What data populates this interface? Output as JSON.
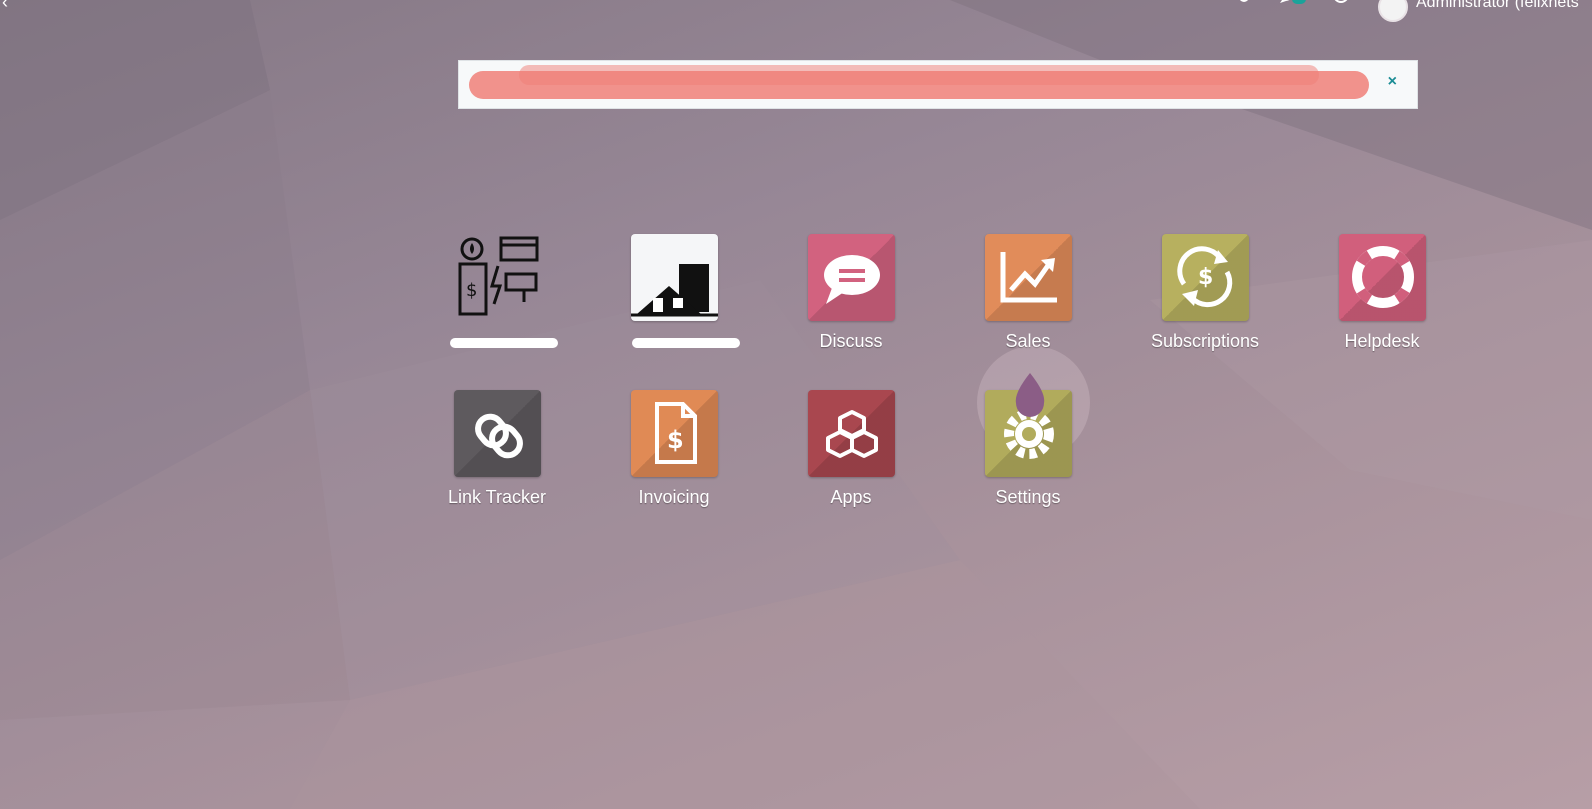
{
  "topbar": {
    "back_icon": "chevron-left-icon",
    "icons": [
      "bug-icon",
      "chat-icon",
      "clock-icon"
    ],
    "user_name": "Administrator (felixnets"
  },
  "notice": {
    "text": "",
    "close_label": "×"
  },
  "apps": [
    {
      "label": "",
      "icon": "utility-bills-icon",
      "color": "#ffffff"
    },
    {
      "label": "",
      "icon": "real-estate-icon",
      "color": "#ffffff"
    },
    {
      "label": "Discuss",
      "icon": "chat-bubble-icon",
      "color": "#d2627f"
    },
    {
      "label": "Sales",
      "icon": "trend-chart-icon",
      "color": "#e18c5a"
    },
    {
      "label": "Subscriptions",
      "icon": "recurring-dollar-icon",
      "color": "#b7b05f"
    },
    {
      "label": "Helpdesk",
      "icon": "lifebuoy-icon",
      "color": "#d15f7c"
    },
    {
      "label": "Link Tracker",
      "icon": "chain-link-icon",
      "color": "#5e5a5e"
    },
    {
      "label": "Invoicing",
      "icon": "invoice-icon",
      "color": "#e08a55"
    },
    {
      "label": "Apps",
      "icon": "cubes-icon",
      "color": "#a9474f"
    },
    {
      "label": "Settings",
      "icon": "gear-icon",
      "color": "#b1ab5c"
    }
  ]
}
